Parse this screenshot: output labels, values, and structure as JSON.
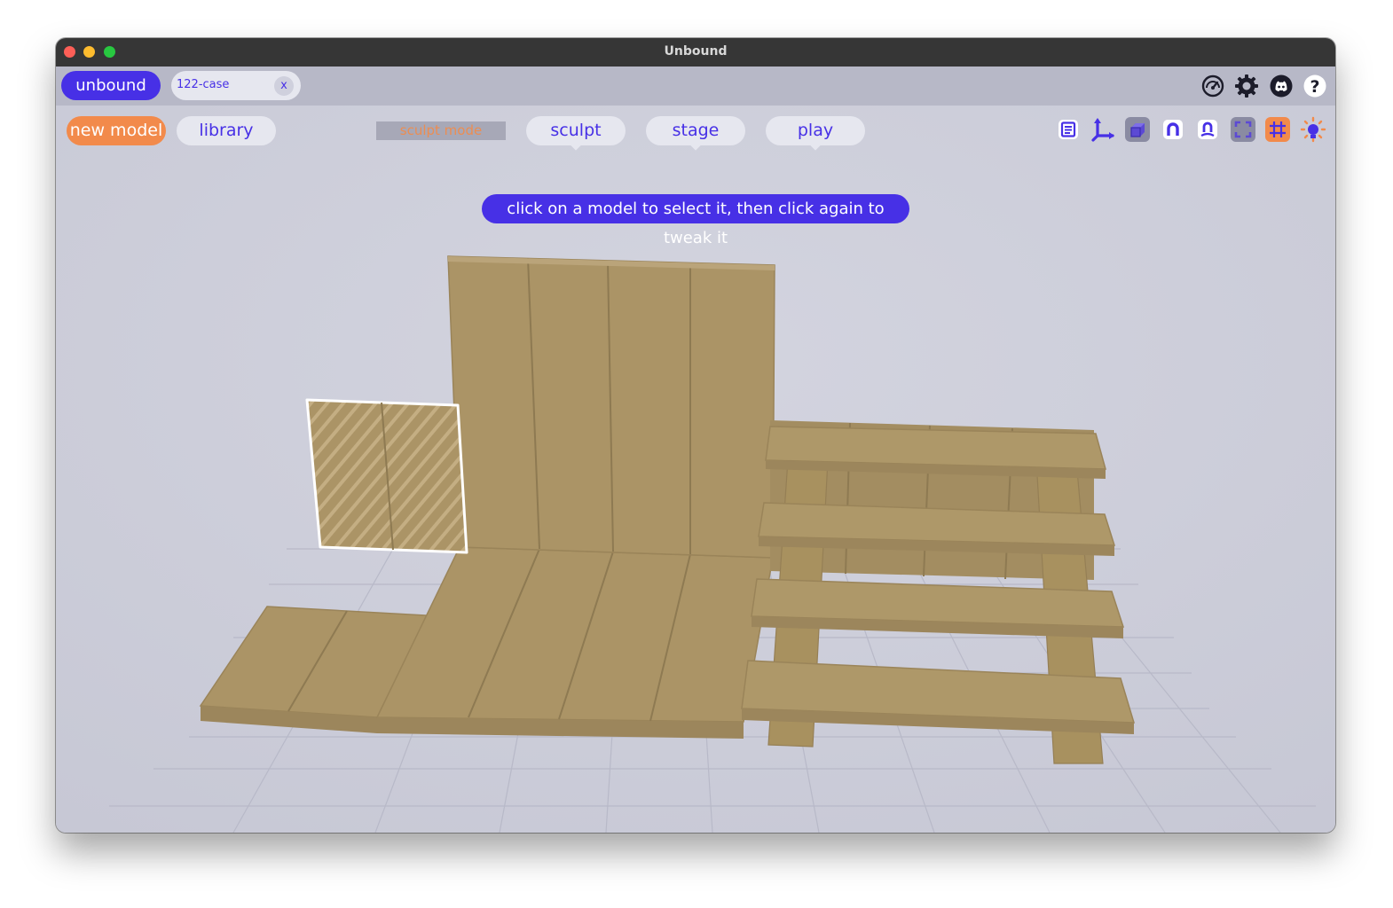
{
  "window": {
    "title": "Unbound"
  },
  "tabbar": {
    "app_label": "unbound",
    "document_tab": {
      "label": "122-case",
      "close_label": "x"
    },
    "icons": [
      "speedometer-icon",
      "gear-icon",
      "discord-icon",
      "help-icon"
    ]
  },
  "toolbar": {
    "new_model_label": "new model",
    "library_label": "library",
    "mode_label": "sculpt mode",
    "nav": [
      {
        "label": "sculpt"
      },
      {
        "label": "stage"
      },
      {
        "label": "play"
      }
    ],
    "tool_icons": [
      "list-icon",
      "axes-icon",
      "box-icon",
      "magnet-icon",
      "snap-icon",
      "frame-icon",
      "grid-icon",
      "light-icon"
    ]
  },
  "hint": {
    "text": "click on a model to select it, then click again to tweak it"
  },
  "colors": {
    "accent": "#4730e6",
    "orange": "#f28a4b",
    "wood": "#ab9466",
    "viewport_bg": "#cfd0dc"
  }
}
